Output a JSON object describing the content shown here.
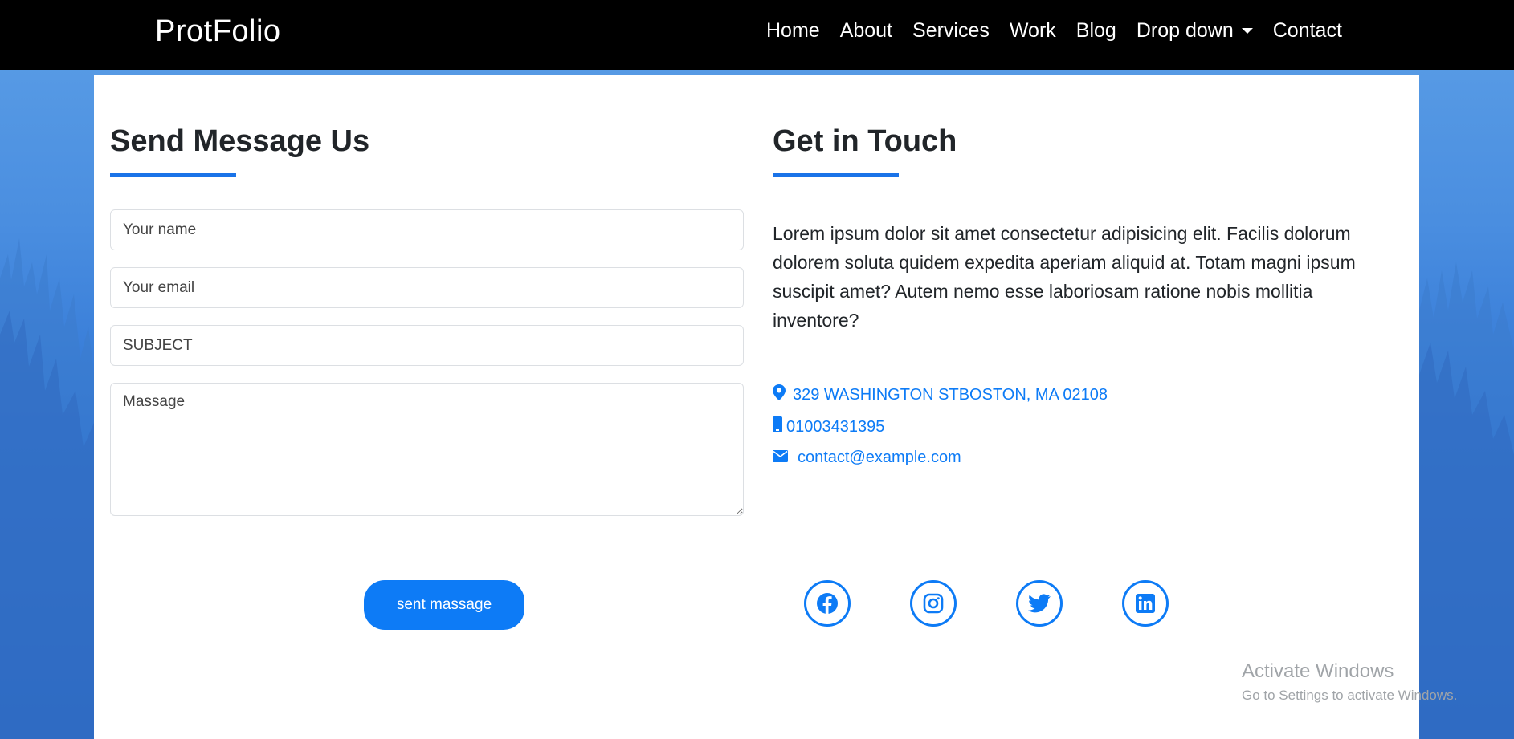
{
  "navbar": {
    "brand": "ProtFolio",
    "items": [
      {
        "label": "Home"
      },
      {
        "label": "About"
      },
      {
        "label": "Services"
      },
      {
        "label": "Work"
      },
      {
        "label": "Blog"
      },
      {
        "label": "Drop down"
      },
      {
        "label": "Contact"
      }
    ]
  },
  "form": {
    "heading": "Send Message Us",
    "name_placeholder": "Your name",
    "email_placeholder": "Your email",
    "subject_placeholder": "SUBJECT",
    "message_placeholder": "Massage",
    "submit_label": "sent massage"
  },
  "contact": {
    "heading": "Get in Touch",
    "paragraph": "Lorem ipsum dolor sit amet consectetur adipisicing elit. Facilis dolorum dolorem soluta quidem expedita aperiam aliquid at. Totam magni ipsum suscipit amet? Autem nemo esse laboriosam ratione nobis mollitia inventore?",
    "address": "329 WASHINGTON STBOSTON, MA 02108",
    "phone": "01003431395",
    "email": "contact@example.com"
  },
  "social": [
    {
      "icon": "facebook-icon"
    },
    {
      "icon": "instagram-icon"
    },
    {
      "icon": "twitter-icon"
    },
    {
      "icon": "linkedin-icon"
    }
  ],
  "watermark": {
    "title": "Activate Windows",
    "subtitle": "Go to Settings to activate Windows."
  },
  "colors": {
    "accent": "#0d7bf6",
    "navbar": "#000000",
    "background": "#3a7fd8"
  }
}
